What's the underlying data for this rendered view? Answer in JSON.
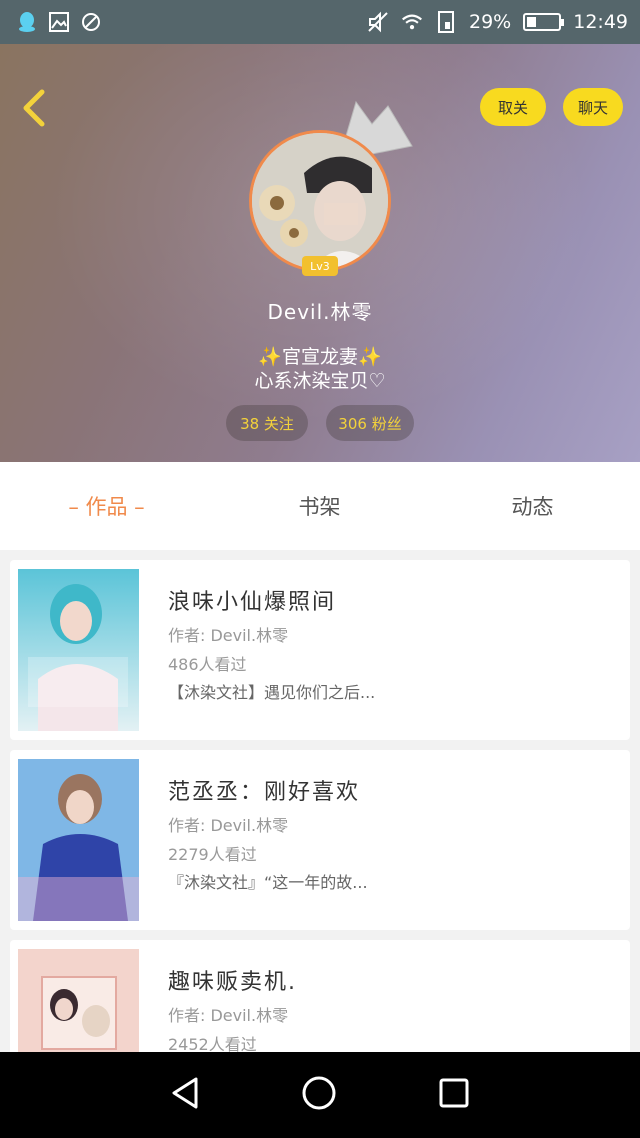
{
  "status_bar": {
    "battery": "29%",
    "time": "12:49",
    "battery_level": 0.29
  },
  "header": {
    "back_icon": "chevron-left-icon",
    "unfollow_label": "取关",
    "chat_label": "聊天",
    "level": "Lv3",
    "username": "Devil.林零",
    "bio_line1": "✨官宣龙妻✨",
    "bio_line2": "心系沐染宝贝♡",
    "following": "38 关注",
    "followers": "306 粉丝"
  },
  "tabs": [
    {
      "label": "– 作品 –"
    },
    {
      "label": "书架"
    },
    {
      "label": "动态"
    }
  ],
  "books": [
    {
      "title": "浪味小仙爆照间",
      "author": "作者: Devil.林零",
      "views": "486人看过",
      "desc": "【沐染文社】遇见你们之后..."
    },
    {
      "title": "范丞丞：刚好喜欢",
      "author": "作者: Devil.林零",
      "views": "2279人看过",
      "desc": "『沐染文社』“这一年的故..."
    },
    {
      "title": "趣味贩卖机.",
      "author": "作者: Devil.林零",
      "views": "2452人看过",
      "desc": ""
    }
  ],
  "colors": {
    "accent": "#f08a4b",
    "button_yellow": "#f8da1f",
    "stat_text": "#f3d23b"
  }
}
